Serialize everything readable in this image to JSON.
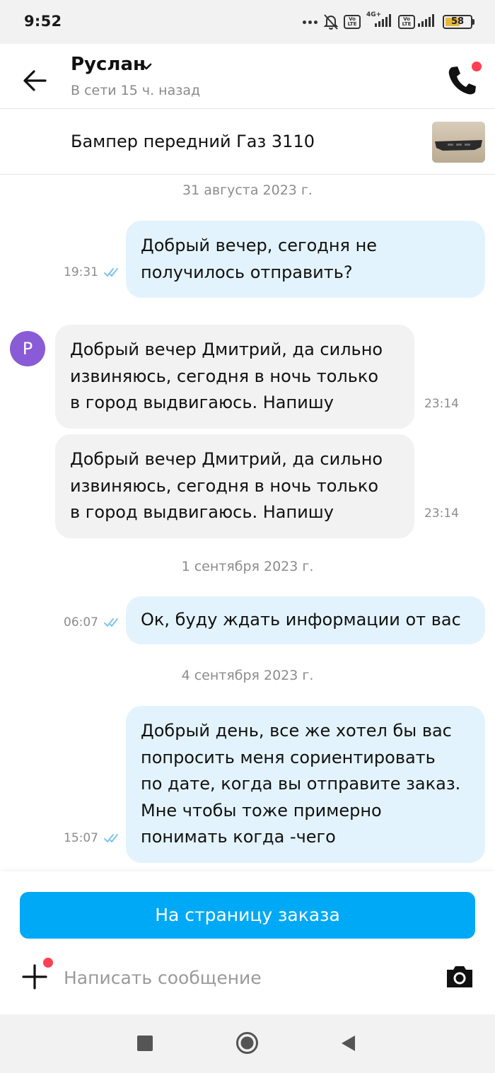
{
  "status_bar": {
    "time": "9:52",
    "network": "4G+",
    "volte": "Vo\nLTE",
    "battery_percent": "58"
  },
  "header": {
    "contact_name": "Руслан",
    "last_seen": "В сети 15 ч. назад"
  },
  "product": {
    "title": "Бампер передний Газ 3110"
  },
  "avatar_letter": "Р",
  "chat": {
    "dates": [
      "31 августа 2023 г.",
      "1 сентября 2023 г.",
      "4 сентября 2023 г."
    ],
    "messages": [
      {
        "direction": "out",
        "lines": [
          "Добрый вечер, сегодня не",
          "получилось отправить?"
        ],
        "time": "19:31",
        "status": "read"
      },
      {
        "direction": "in",
        "lines": [
          "Добрый вечер Дмитрий, да сильно",
          "извиняюсь, сегодня в ночь только",
          "в город выдвигаюсь. Напишу"
        ],
        "time": "23:14"
      },
      {
        "direction": "in",
        "lines": [
          "Добрый вечер Дмитрий, да сильно",
          "извиняюсь, сегодня в ночь только",
          "в город выдвигаюсь. Напишу"
        ],
        "time": "23:14"
      },
      {
        "direction": "out",
        "lines": [
          "Ок, буду ждать информации от вас"
        ],
        "time": "06:07",
        "status": "read"
      },
      {
        "direction": "out",
        "lines": [
          "Добрый день, все же хотел бы вас",
          "попросить меня сориентировать",
          "по дате, когда вы отправите заказ.",
          "Мне чтобы тоже примерно",
          "понимать когда -чего"
        ],
        "time": "15:07",
        "status": "read"
      }
    ]
  },
  "order_button": {
    "label": "На страницу заказа"
  },
  "composer": {
    "placeholder": "Написать сообщение"
  },
  "colors": {
    "accent": "#00a9f5",
    "outgoing_bubble": "#e3f3fd",
    "incoming_bubble": "#f2f2f2",
    "avatar": "#8a5bd6",
    "notification_dot": "#ff4053",
    "read_ticks": "#7cc4ee"
  },
  "icons": {
    "back": "arrow-left-icon",
    "dropdown": "chevron-down-icon",
    "call": "phone-icon",
    "attach": "plus-icon",
    "camera": "camera-icon",
    "read": "double-check-icon",
    "nav_recent": "square-icon",
    "nav_home": "circle-icon",
    "nav_back": "triangle-back-icon"
  }
}
